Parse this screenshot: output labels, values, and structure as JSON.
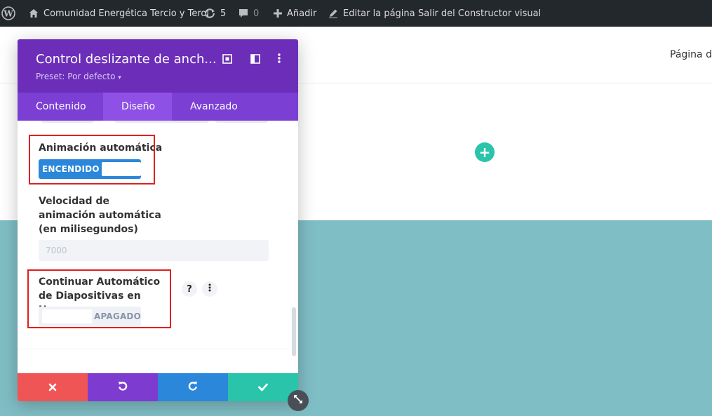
{
  "adminbar": {
    "site_name": "Comunidad Energética Tercio y Terol",
    "updates_count": "5",
    "comments_count": "0",
    "add_new": "Añadir",
    "edit_page": "Editar la página",
    "exit_builder": "Salir del Constructor visual"
  },
  "page": {
    "nav_item": "Página de"
  },
  "modal": {
    "title": "Control deslizante de anch...",
    "preset": "Preset: Por defecto",
    "tabs": [
      {
        "label": "Contenido"
      },
      {
        "label": "Diseño"
      },
      {
        "label": "Avanzado"
      }
    ],
    "auto_animation": {
      "label": "Animación automática",
      "toggle_label": "ENCENDIDO"
    },
    "animation_speed": {
      "label": "Velocidad de animación automática (en milisegundos)",
      "placeholder": "7000"
    },
    "continue_hover": {
      "label": "Continuar Automático de Diapositivas en Hover",
      "toggle_label": "APAGADO",
      "help": "?"
    }
  },
  "colors": {
    "header": "#6c2eb9",
    "tabs": "#7b3fd3",
    "toggle_on": "#2b87da",
    "cancel": "#ef5555",
    "undo": "#7e3bd0",
    "redo": "#2b87da",
    "save": "#29c4a9",
    "teal_bg": "#7fbec5"
  }
}
